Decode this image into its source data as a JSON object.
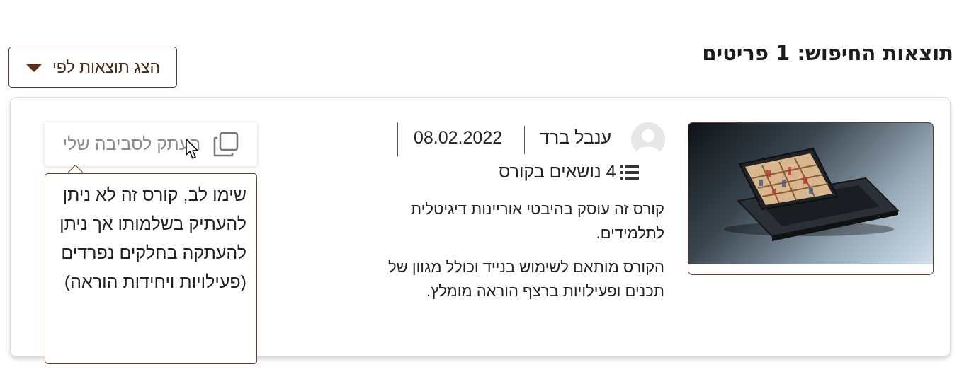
{
  "search": {
    "title": "תוצאות החיפוש: 1 פריטים",
    "sort_button_label": "הצג תוצאות לפי",
    "sort_caret_icon": "caret-down-icon"
  },
  "course": {
    "author": "ענבל ברד",
    "date": "08.02.2022",
    "topics_label": "4 נושאים בקורס",
    "topics_icon": "list-icon",
    "avatar_icon": "user-avatar-icon",
    "description": [
      "קורס זה עוסק בהיבטי אוריינות דיגיטלית לתלמידים.",
      "הקורס מותאם לשימוש בנייד וכולל מגוון של תכנים ופעילויות ברצף הוראה מומלץ."
    ],
    "copy_button_label": "העתק לסביבה שלי",
    "copy_icon": "copy-icon",
    "tooltip": "שימו לב, קורס זה לא ניתן להעתיק בשלמותו אך ניתן להעתקה בחלקים נפרדים (פעילויות ויחידות הוראה)"
  },
  "colors": {
    "accent": "#5a2e1c",
    "card_border": "#ead9d3",
    "muted_text": "#8c8c8c"
  }
}
